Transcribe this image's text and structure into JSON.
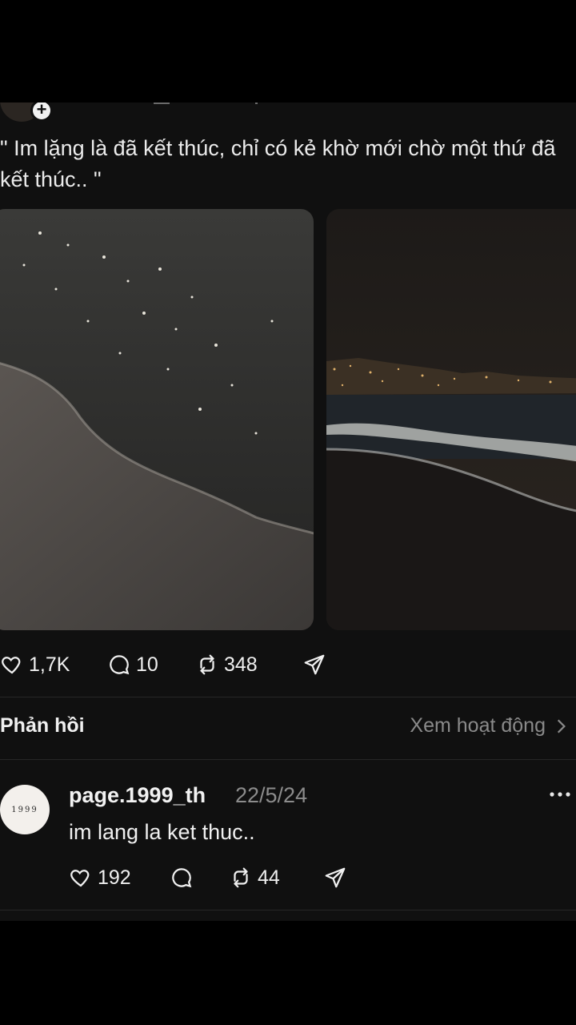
{
  "post": {
    "text": "\" Im lặng là đã kết thúc, chỉ có kẻ khờ mới chờ một thứ đã kết thúc.. \"",
    "likes": "1,7K",
    "comments": "10",
    "reposts": "348"
  },
  "replies_section": {
    "label": "Phản hồi",
    "view_activity": "Xem hoạt động"
  },
  "reply": {
    "avatar_text": "1999",
    "username": "page.1999_th",
    "date": "22/5/24",
    "text": "im lang la ket thuc..",
    "likes": "192",
    "reposts": "44"
  },
  "colors": {
    "background": "#000000",
    "panel": "#101010",
    "muted": "#8a8a8a"
  }
}
